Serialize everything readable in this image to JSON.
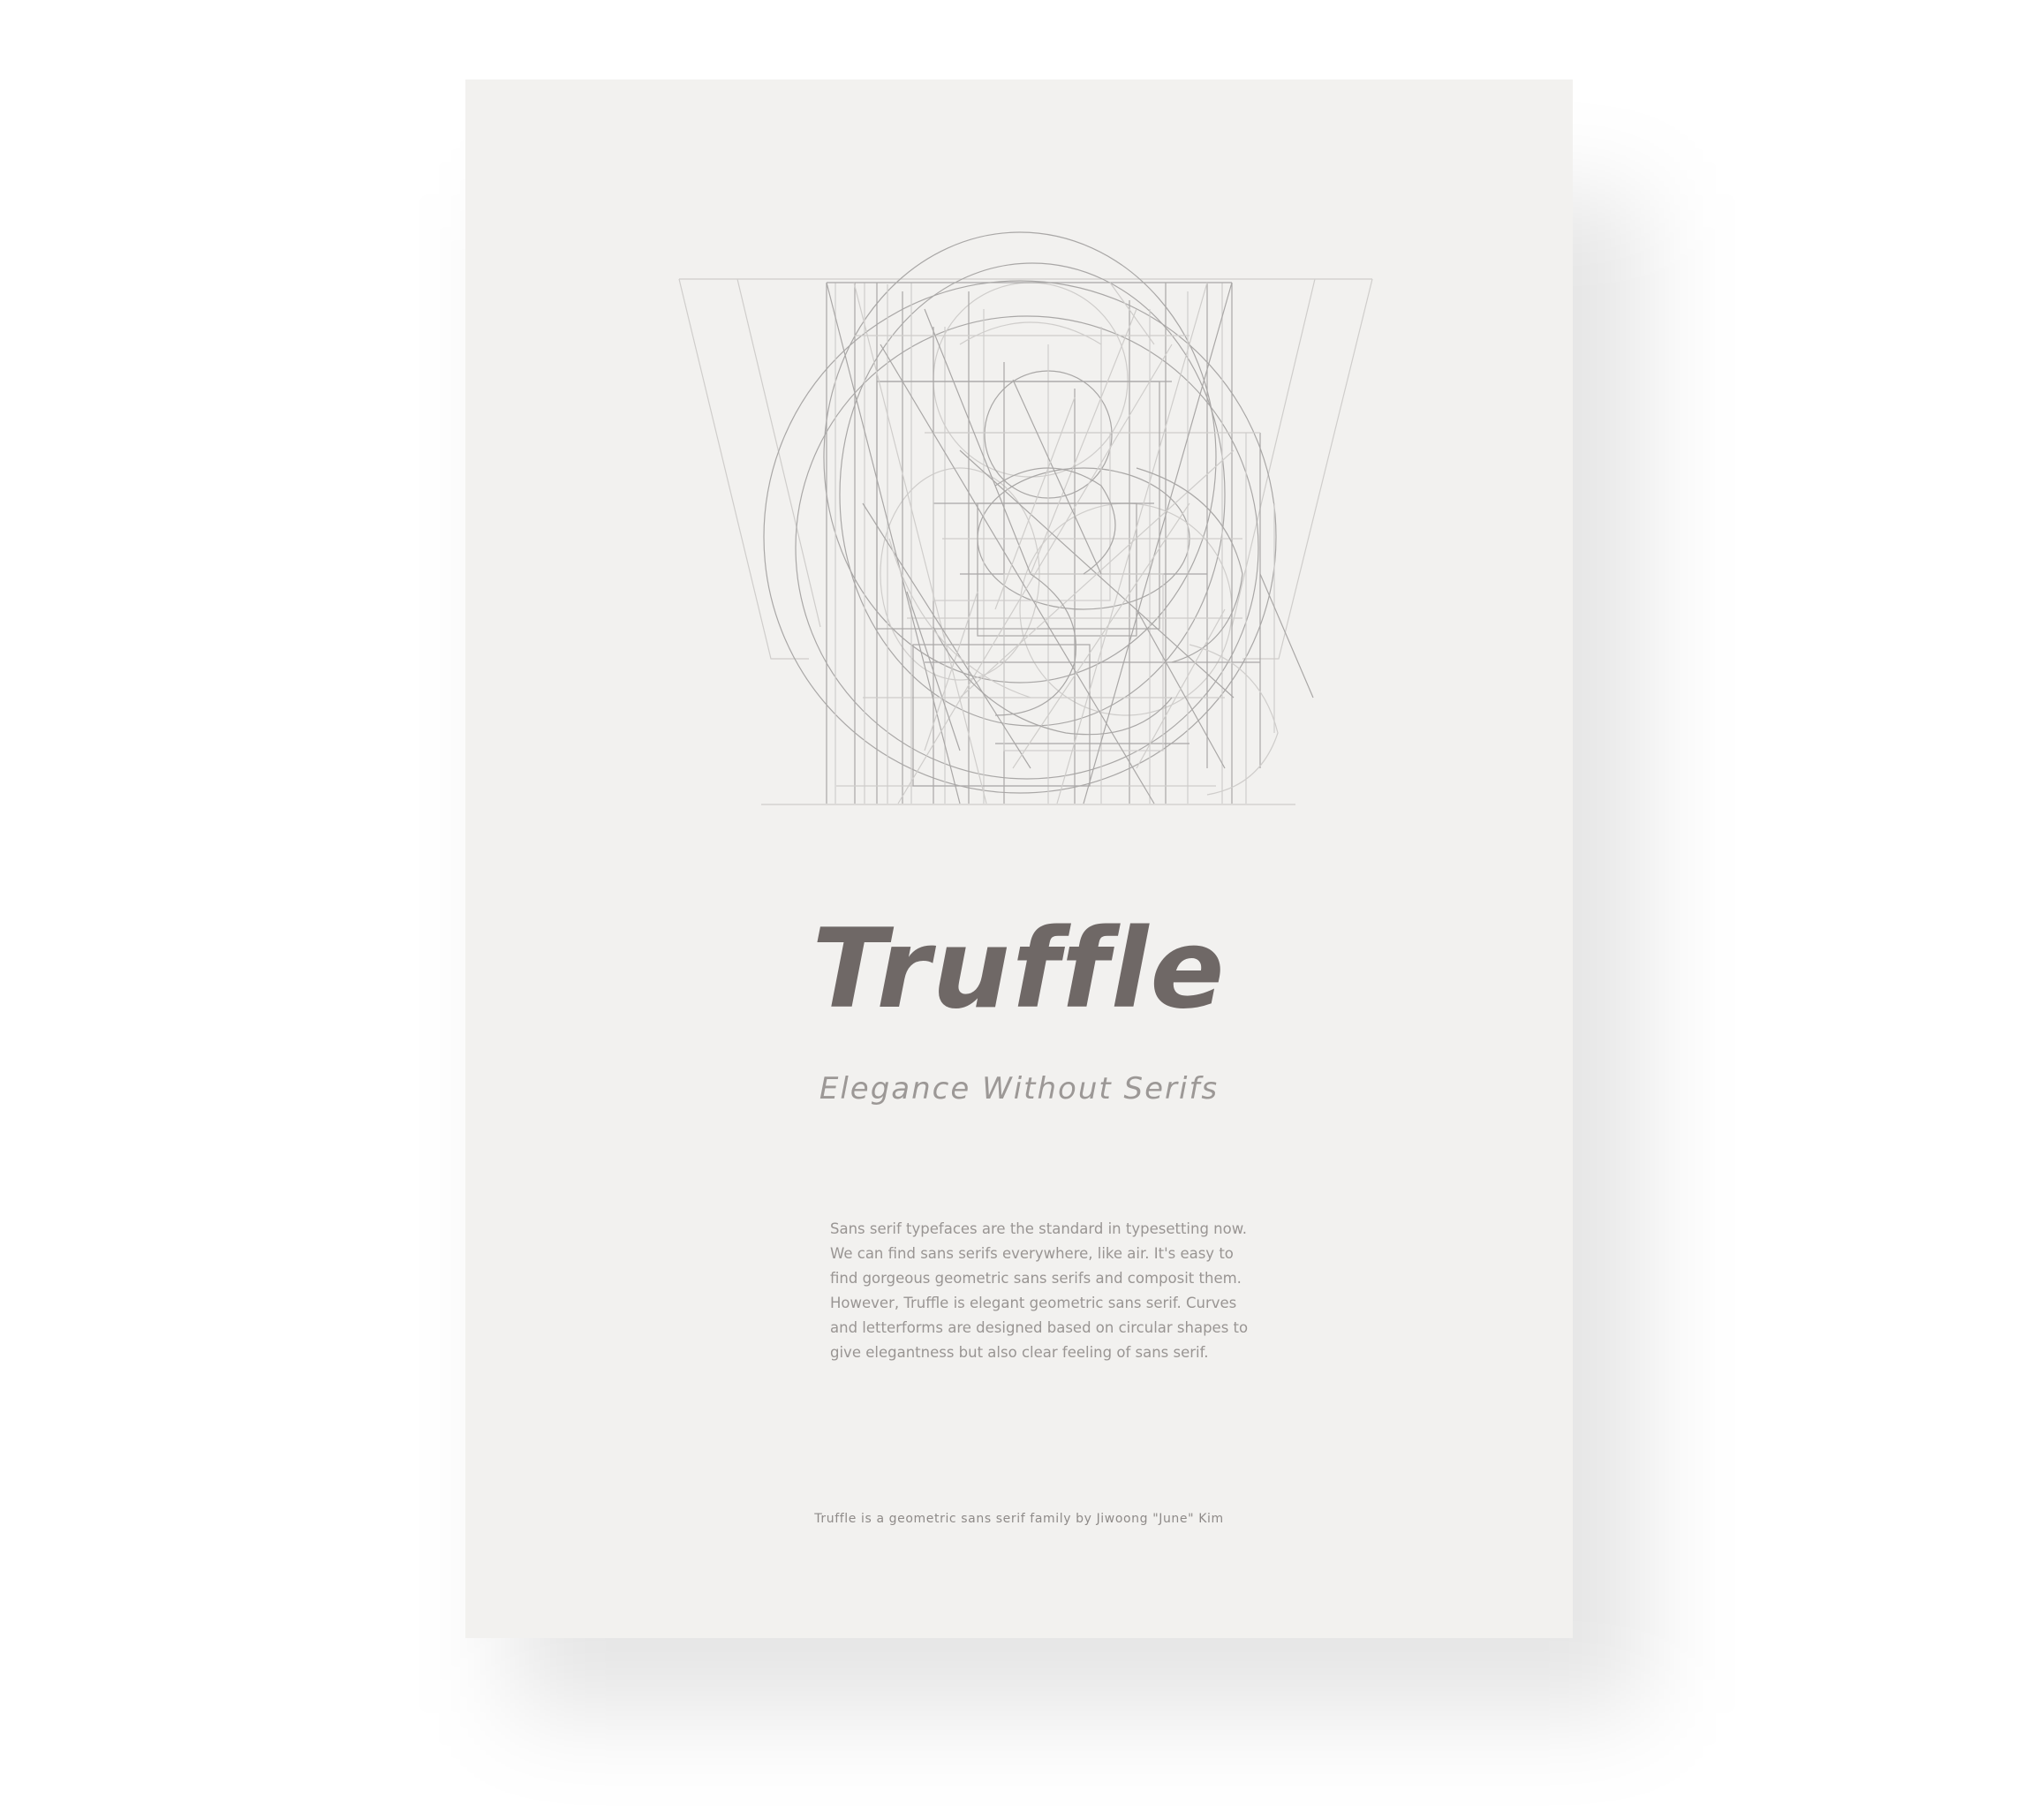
{
  "poster": {
    "title": "Truffle",
    "subtitle": "Elegance Without Serifs",
    "body_lines": [
      "Sans serif typefaces are the standard in typesetting now.",
      "We can find sans serifs everywhere, like air. It's easy to",
      "find gorgeous geometric sans serifs and composit them.",
      "However, Truffle is elegant geometric sans serif. Curves",
      "and letterforms are designed based on circular shapes to",
      "give elegantness but also clear feeling of sans serif."
    ],
    "credit": "Truffle is a geometric sans serif family by Jiwoong \"June\" Kim"
  },
  "colors": {
    "paper": "#f2f1ef",
    "title": "#6f6866",
    "subtitle": "#9c9896",
    "body": "#999593",
    "construction_lines": "#a9a7a6"
  }
}
